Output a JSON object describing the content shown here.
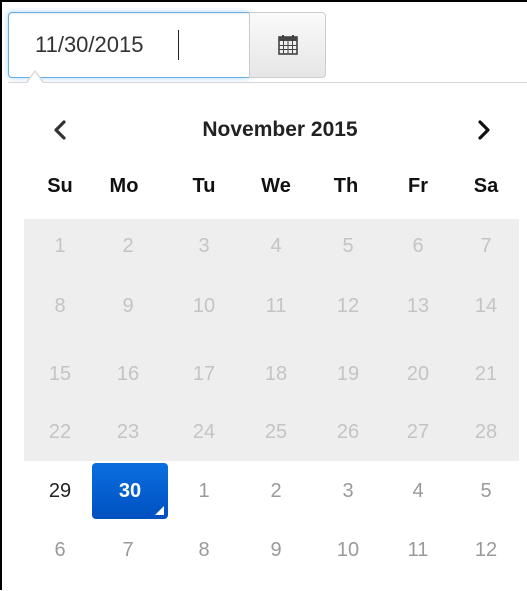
{
  "input": {
    "value": "11/30/2015"
  },
  "calendar_button": {
    "icon": "calendar-icon"
  },
  "header": {
    "prev_icon": "chevron-left-icon",
    "next_icon": "chevron-right-icon",
    "month_title": "November 2015"
  },
  "weekdays": [
    "Su",
    "Mo",
    "Tu",
    "We",
    "Th",
    "Fr",
    "Sa"
  ],
  "weeks": [
    [
      "1",
      "2",
      "3",
      "4",
      "5",
      "6",
      "7"
    ],
    [
      "8",
      "9",
      "10",
      "11",
      "12",
      "13",
      "14"
    ],
    [
      "15",
      "16",
      "17",
      "18",
      "19",
      "20",
      "21"
    ],
    [
      "22",
      "23",
      "24",
      "25",
      "26",
      "27",
      "28"
    ],
    [
      "29",
      "30",
      "1",
      "2",
      "3",
      "4",
      "5"
    ],
    [
      "6",
      "7",
      "8",
      "9",
      "10",
      "11",
      "12"
    ]
  ],
  "selected_day": "30",
  "colors": {
    "selected_bg": "#0a6fe0",
    "disabled_band": "#eeeeee",
    "focus_border": "#66afe9"
  }
}
